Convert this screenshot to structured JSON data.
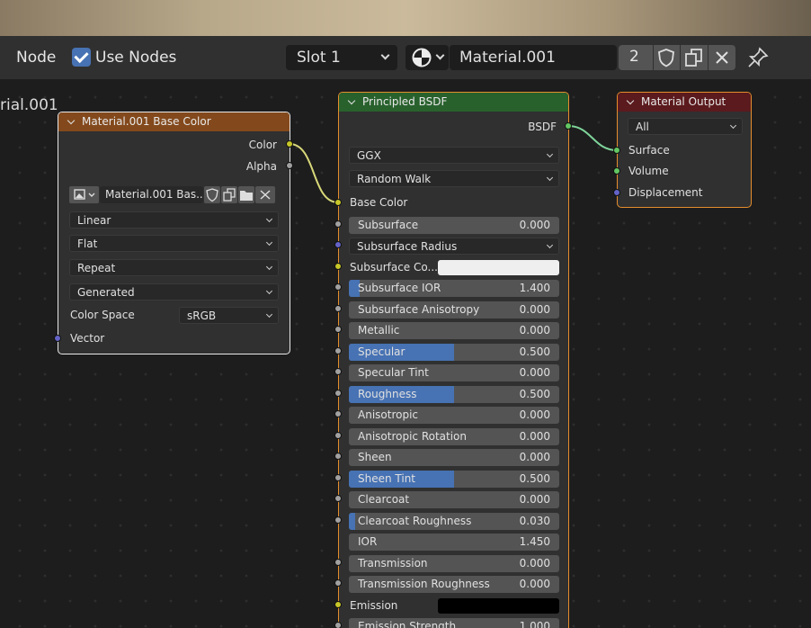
{
  "header": {
    "editor_label": "Node",
    "use_nodes_label": "Use Nodes",
    "use_nodes_checked": true,
    "slot_label": "Slot 1",
    "material_name": "Material.001",
    "user_count": "2"
  },
  "canvas": {
    "tree_label": "rial.001"
  },
  "image_node": {
    "title": "Material.001 Base Color",
    "outputs": [
      "Color",
      "Alpha"
    ],
    "image_name": "Material.001 Bas...",
    "interpolation": "Linear",
    "projection": "Flat",
    "extension": "Repeat",
    "source": "Generated",
    "color_space_label": "Color Space",
    "color_space": "sRGB",
    "input_vector": "Vector"
  },
  "bsdf_node": {
    "title": "Principled BSDF",
    "output": "BSDF",
    "distribution": "GGX",
    "subsurface_method": "Random Walk",
    "base_color_label": "Base Color",
    "subsurface_radius_label": "Subsurface Radius",
    "subsurface_color_label": "Subsurface Co...",
    "subsurface_color": "#efefef",
    "emission_label": "Emission",
    "emission_color": "#000000",
    "fields": [
      {
        "label": "Subsurface",
        "value": "0.000",
        "fraction": 0
      },
      {
        "label": "Subsurface IOR",
        "value": "1.400",
        "fraction": 0.05
      },
      {
        "label": "Subsurface Anisotropy",
        "value": "0.000",
        "fraction": 0
      },
      {
        "label": "Metallic",
        "value": "0.000",
        "fraction": 0
      },
      {
        "label": "Specular",
        "value": "0.500",
        "fraction": 0.5
      },
      {
        "label": "Specular Tint",
        "value": "0.000",
        "fraction": 0
      },
      {
        "label": "Roughness",
        "value": "0.500",
        "fraction": 0.5
      },
      {
        "label": "Anisotropic",
        "value": "0.000",
        "fraction": 0
      },
      {
        "label": "Anisotropic Rotation",
        "value": "0.000",
        "fraction": 0
      },
      {
        "label": "Sheen",
        "value": "0.000",
        "fraction": 0
      },
      {
        "label": "Sheen Tint",
        "value": "0.500",
        "fraction": 0.5
      },
      {
        "label": "Clearcoat",
        "value": "0.000",
        "fraction": 0
      },
      {
        "label": "Clearcoat Roughness",
        "value": "0.030",
        "fraction": 0.03
      },
      {
        "label": "IOR",
        "value": "1.450",
        "fraction": 0
      },
      {
        "label": "Transmission",
        "value": "0.000",
        "fraction": 0
      },
      {
        "label": "Transmission Roughness",
        "value": "0.000",
        "fraction": 0
      },
      {
        "label": "Emission Strength",
        "value": "1.000",
        "fraction": 0
      }
    ]
  },
  "output_node": {
    "title": "Material Output",
    "target": "All",
    "inputs": [
      "Surface",
      "Volume",
      "Displacement"
    ]
  },
  "colors": {
    "accent": "#4772b3",
    "image_header": "#83491c",
    "bsdf_header": "#29612d",
    "output_header": "#5b1a1d",
    "selected_border": "#e58e2d"
  }
}
